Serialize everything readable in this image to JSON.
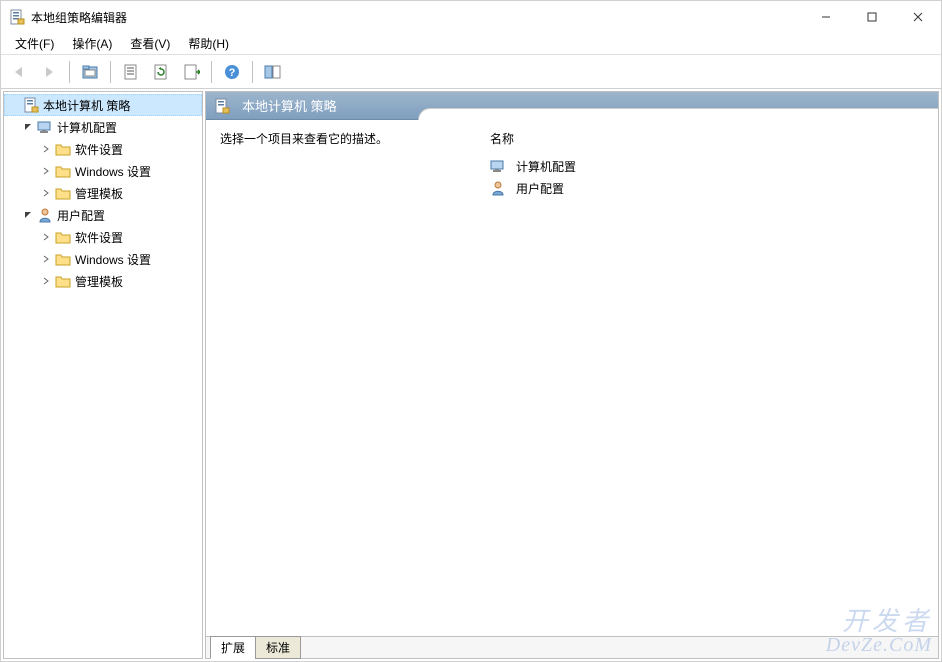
{
  "window": {
    "title": "本地组策略编辑器"
  },
  "menu": {
    "file": "文件(F)",
    "action": "操作(A)",
    "view": "查看(V)",
    "help": "帮助(H)"
  },
  "toolbar": {
    "back": "后退",
    "forward": "前进",
    "up": "向上",
    "properties": "属性",
    "refresh": "刷新",
    "export": "导出列表",
    "help": "帮助",
    "show_hide": "显示/隐藏"
  },
  "tree": {
    "root": "本地计算机 策略",
    "computer": "计算机配置",
    "user": "用户配置",
    "software": "软件设置",
    "windows": "Windows 设置",
    "templates": "管理模板"
  },
  "details": {
    "header": "本地计算机 策略",
    "desc_prompt": "选择一个项目来查看它的描述。",
    "name_header": "名称",
    "items": {
      "computer": "计算机配置",
      "user": "用户配置"
    }
  },
  "tabs": {
    "extended": "扩展",
    "standard": "标准"
  },
  "watermark": {
    "line1": "开发者",
    "line2": "DevZe.CoM"
  }
}
